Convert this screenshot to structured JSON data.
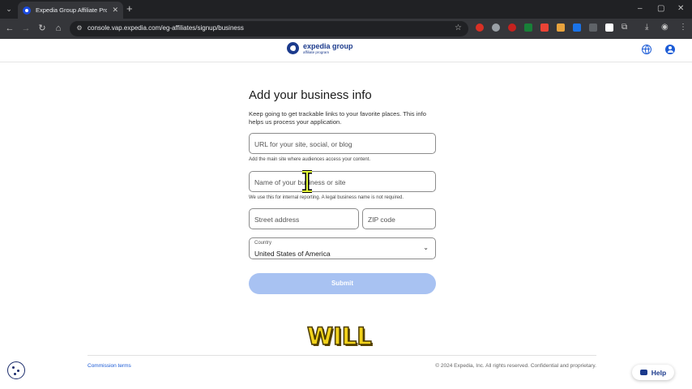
{
  "browser": {
    "tab_title": "Expedia Group Affiliate Program",
    "new_tab": "+",
    "url": "console.vap.expedia.com/eg-affiliates/signup/business",
    "window_controls": {
      "minimize": "–",
      "maximize": "▢",
      "close": "✕"
    },
    "extension_colors": [
      "#d93025",
      "#9aa0a6",
      "#c5221f",
      "#188038",
      "#ea4335",
      "#e8a33d",
      "#1a73e8",
      "#5f6368",
      "#ffffff"
    ]
  },
  "header": {
    "logo_name": "expedia group",
    "logo_sub": "affiliate program"
  },
  "form": {
    "title": "Add your business info",
    "subtitle": "Keep going to get trackable links to your favorite places. This info helps us process your application.",
    "url_placeholder": "URL for your site, social, or blog",
    "url_help": "Add the main site where audiences access your content.",
    "business_placeholder": "Name of your business or site",
    "business_help": "We use this for internal reporting. A legal business name is not required.",
    "street_placeholder": "Street address",
    "zip_placeholder": "ZIP code",
    "country_label": "Country",
    "country_value": "United States of America",
    "submit_label": "Submit"
  },
  "overlay_text": "WILL",
  "footer": {
    "commission_terms": "Commission terms",
    "copyright": "© 2024 Expedia, Inc. All rights reserved. Confidential and proprietary."
  },
  "help_button": "Help",
  "colors": {
    "brand_blue": "#1b3a8c",
    "link_blue": "#1b5bd6",
    "submit_disabled": "#a8c2f2"
  }
}
